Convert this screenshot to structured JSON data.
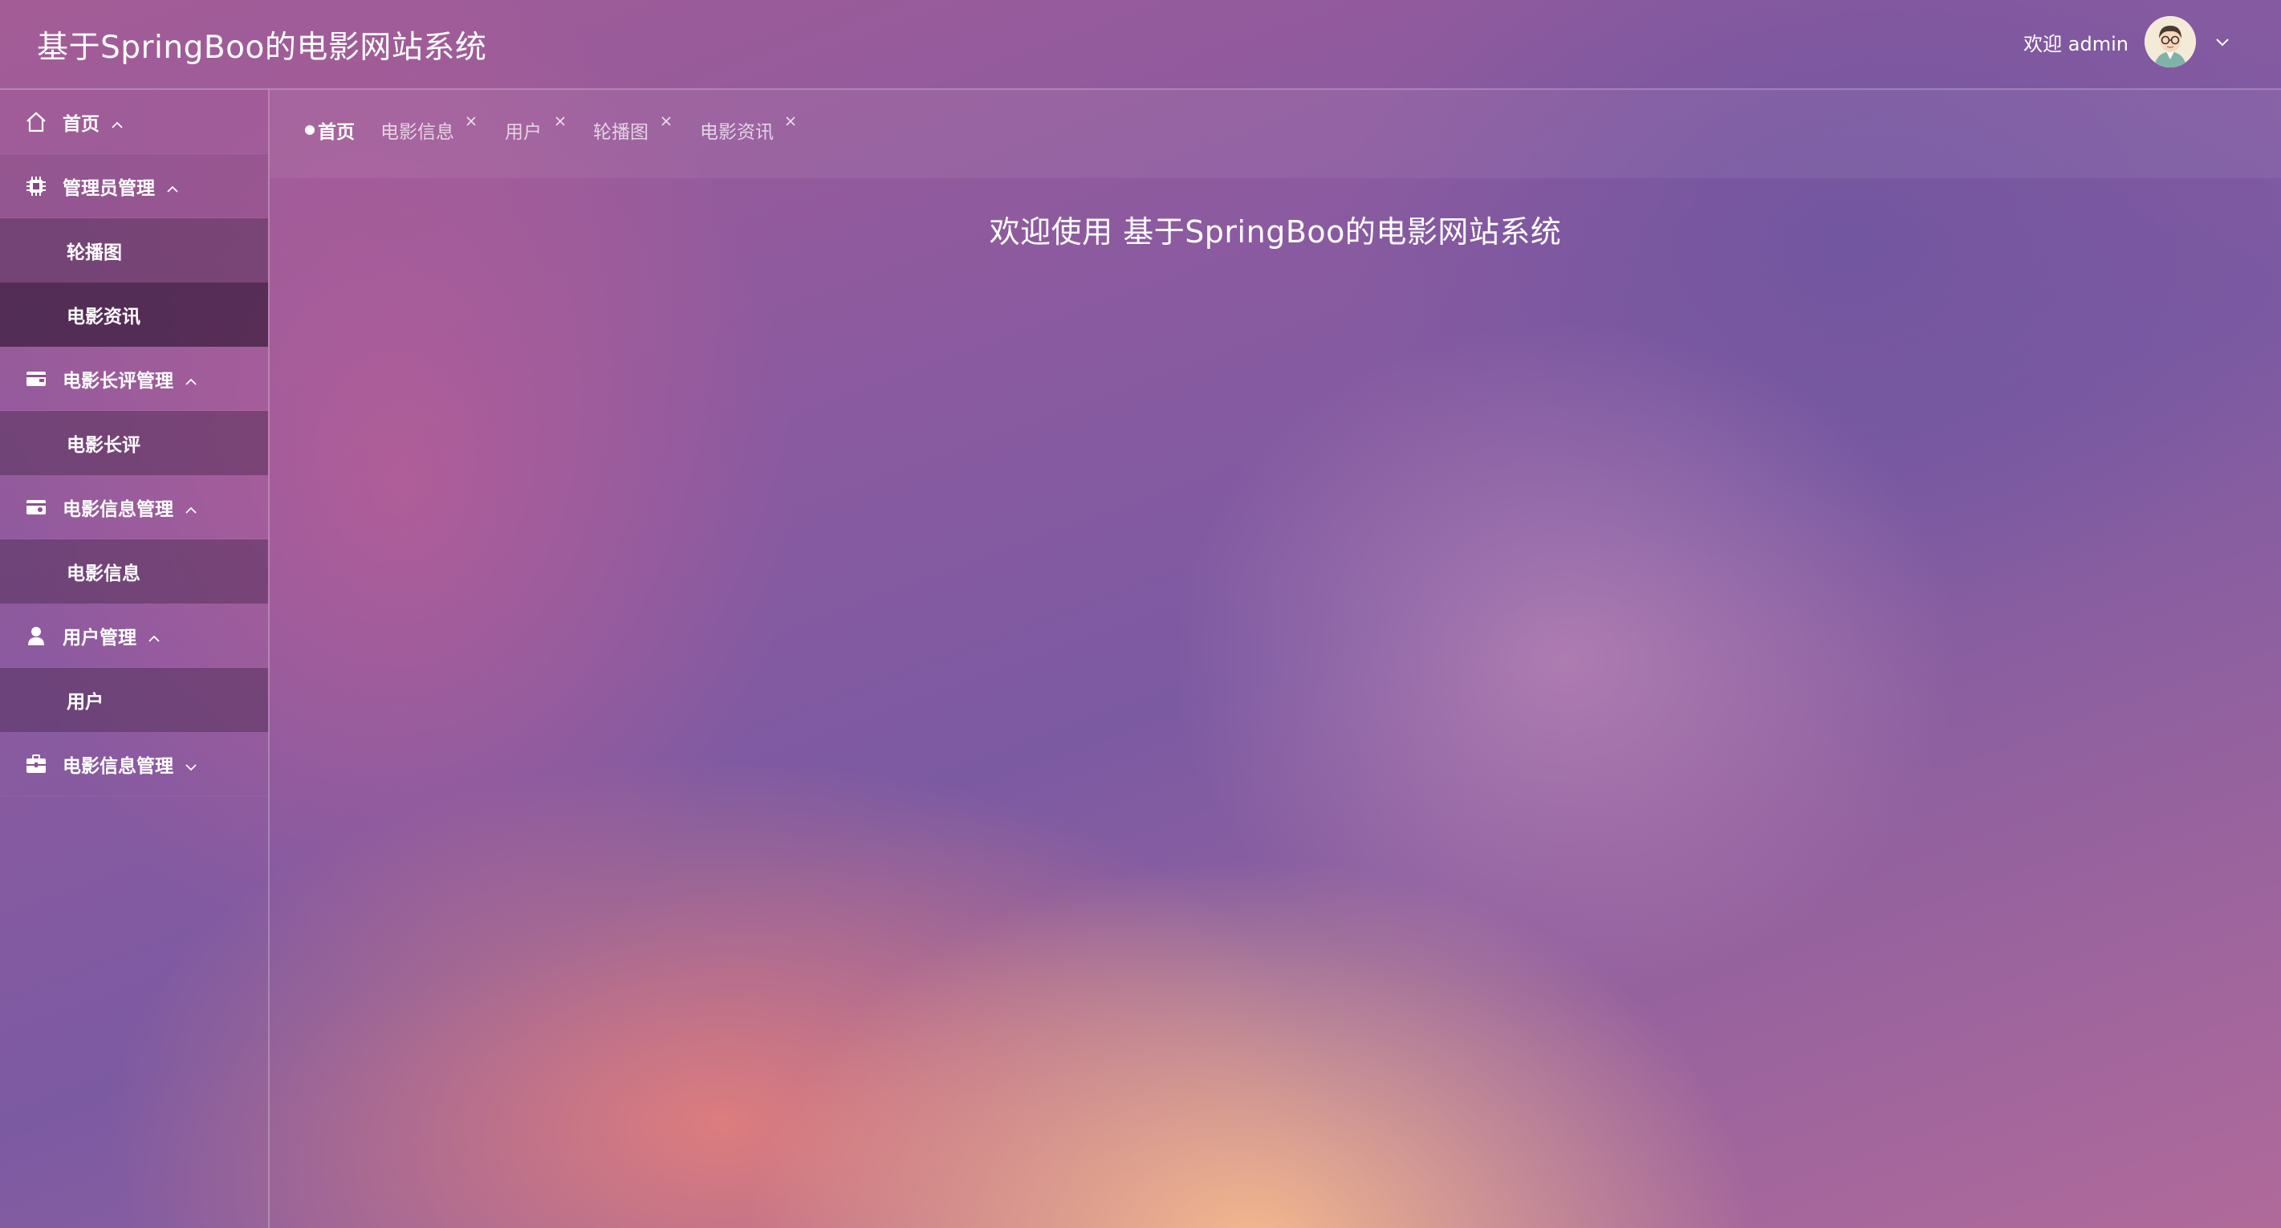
{
  "app": {
    "title": "基于SpringBoo的电影网站系统"
  },
  "user": {
    "welcome": "欢迎 admin",
    "avatar": "avatar-image"
  },
  "sidebar": {
    "items": [
      {
        "label": "首页",
        "icon": "home-icon",
        "caret": "up"
      },
      {
        "label": "管理员管理",
        "icon": "chip-icon",
        "caret": "up"
      },
      {
        "label": "轮播图"
      },
      {
        "label": "电影资讯",
        "active": true
      },
      {
        "label": "电影长评管理",
        "icon": "wallet-icon",
        "caret": "up"
      },
      {
        "label": "电影长评"
      },
      {
        "label": "电影信息管理",
        "icon": "card-icon",
        "caret": "up"
      },
      {
        "label": "电影信息"
      },
      {
        "label": "用户管理",
        "icon": "user-icon",
        "caret": "up"
      },
      {
        "label": "用户"
      },
      {
        "label": "电影信息管理",
        "icon": "briefcase-icon",
        "caret": "down"
      }
    ]
  },
  "tabs": [
    {
      "label": "首页",
      "active": true
    },
    {
      "label": "电影信息",
      "closable": true
    },
    {
      "label": "用户",
      "closable": true
    },
    {
      "label": "轮播图",
      "closable": true
    },
    {
      "label": "电影资讯",
      "closable": true
    }
  ],
  "main": {
    "welcome_title": "欢迎使用 基于SpringBoo的电影网站系统"
  },
  "colors": {
    "text": "#ffffff",
    "active_submenu_bg": "#3a1c3f",
    "submenu_bg": "#5a3360"
  }
}
